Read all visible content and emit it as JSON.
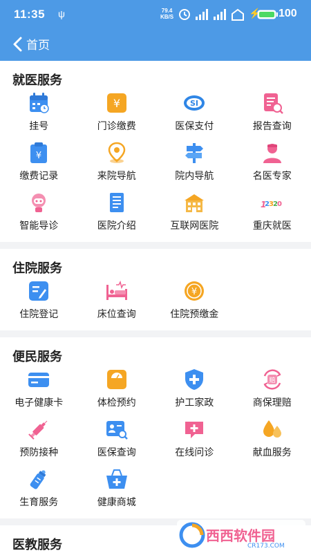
{
  "status": {
    "time": "11:35",
    "speed_value": "79.4",
    "speed_unit": "KB/S",
    "battery": "100"
  },
  "nav": {
    "title": "首页"
  },
  "sections": [
    {
      "title": "就医服务",
      "items": [
        {
          "label": "挂号",
          "icon": "calendar-icon"
        },
        {
          "label": "门诊缴费",
          "icon": "yuan-card-icon"
        },
        {
          "label": "医保支付",
          "icon": "si-logo-icon"
        },
        {
          "label": "报告查询",
          "icon": "report-search-icon"
        },
        {
          "label": "缴费记录",
          "icon": "payment-record-icon"
        },
        {
          "label": "来院导航",
          "icon": "map-pin-icon"
        },
        {
          "label": "院内导航",
          "icon": "signpost-icon"
        },
        {
          "label": "名医专家",
          "icon": "doctor-icon"
        },
        {
          "label": "智能导诊",
          "icon": "robot-icon"
        },
        {
          "label": "医院介绍",
          "icon": "document-icon"
        },
        {
          "label": "互联网医院",
          "icon": "hospital-building-icon"
        },
        {
          "label": "重庆就医",
          "icon": "12320-logo-icon"
        }
      ]
    },
    {
      "title": "住院服务",
      "items": [
        {
          "label": "住院登记",
          "icon": "register-icon"
        },
        {
          "label": "床位查询",
          "icon": "bed-icon"
        },
        {
          "label": "住院预缴金",
          "icon": "yuan-coin-icon"
        }
      ]
    },
    {
      "title": "便民服务",
      "items": [
        {
          "label": "电子健康卡",
          "icon": "health-card-icon"
        },
        {
          "label": "体检预约",
          "icon": "scale-icon"
        },
        {
          "label": "护工家政",
          "icon": "shield-plus-icon"
        },
        {
          "label": "商保理赔",
          "icon": "claim-icon"
        },
        {
          "label": "预防接种",
          "icon": "syringe-icon"
        },
        {
          "label": "医保查询",
          "icon": "id-search-icon"
        },
        {
          "label": "在线问诊",
          "icon": "chat-plus-icon"
        },
        {
          "label": "献血服务",
          "icon": "blood-drop-icon"
        },
        {
          "label": "生育服务",
          "icon": "baby-bottle-icon"
        },
        {
          "label": "健康商城",
          "icon": "basket-icon"
        }
      ]
    },
    {
      "title": "医教服务",
      "items": []
    }
  ],
  "watermark": {
    "brand": "西西软件园",
    "domain": "CR173.COM"
  },
  "colors": {
    "primary": "#4d9ae6",
    "orange": "#f5a623",
    "pink": "#f06292",
    "blue": "#3d8ff0"
  }
}
